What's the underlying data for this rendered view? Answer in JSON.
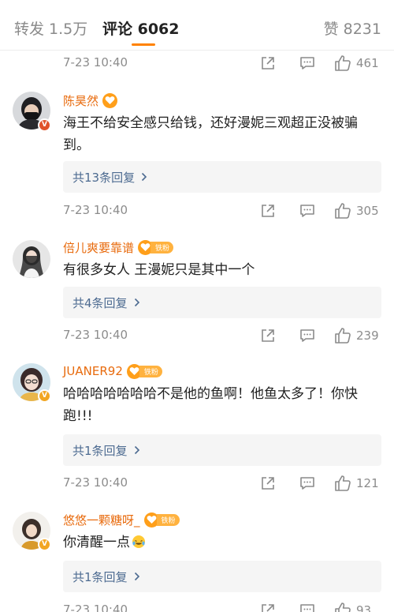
{
  "tabs": {
    "forward": "转发 1.5万",
    "comments": "评论 6062",
    "likes": "赞 8231"
  },
  "colors": {
    "accent": "#ff8200",
    "username": "#e86b0e",
    "reply_link": "#4d6b91",
    "verified_badge": "#e0532b",
    "fan_badge": "#ffb23f"
  },
  "top_meta": {
    "time": "7-23 10:40",
    "like_count": "461"
  },
  "comments": [
    {
      "username": "陈昊然",
      "badge_text": "",
      "text": "海王不给安全感只给钱，还好漫妮三观超正没被骗到。",
      "replies": "共13条回复",
      "time": "7-23 10:40",
      "like_count": "305"
    },
    {
      "username": "倍儿爽要靠谱",
      "badge_text": "铁粉",
      "text": "有很多女人 王漫妮只是其中一个",
      "replies": "共4条回复",
      "time": "7-23 10:40",
      "like_count": "239"
    },
    {
      "username": "JUANER92",
      "badge_text": "铁粉",
      "text": "哈哈哈哈哈哈哈不是他的鱼啊！他鱼太多了！你快跑!!!",
      "replies": "共1条回复",
      "time": "7-23 10:40",
      "like_count": "121"
    },
    {
      "username": "悠悠一颗糖呀_",
      "badge_text": "铁粉",
      "text": "你清醒一点",
      "replies": "共1条回复",
      "time": "7-23 10:40",
      "like_count": "93"
    }
  ]
}
